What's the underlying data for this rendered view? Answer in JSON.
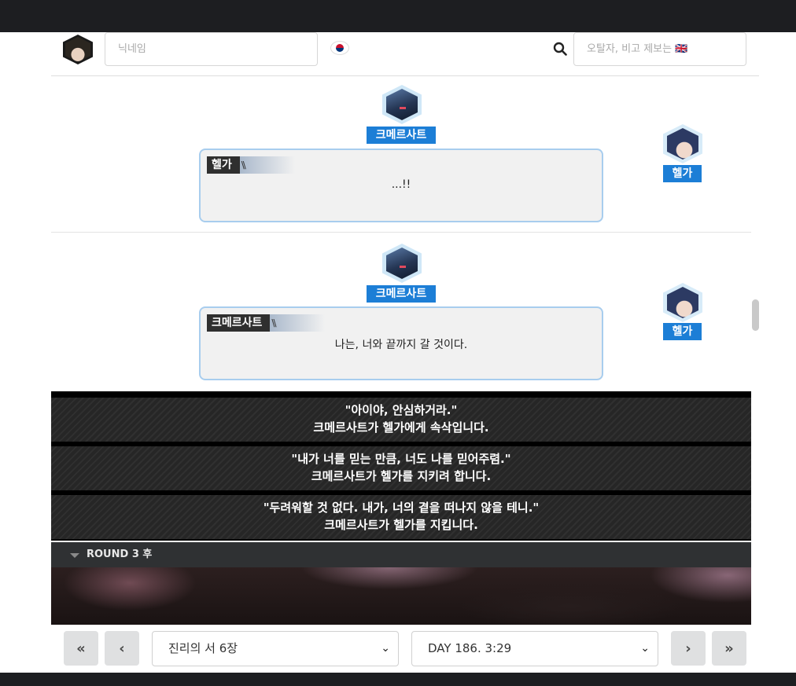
{
  "header": {
    "nickname_placeholder": "닉네임",
    "report_placeholder": "오탈자, 비고 제보는 🇬🇧"
  },
  "messages": [
    {
      "speaker": "크메르사트",
      "target": "헬가",
      "label": "헬가",
      "text": "...!!"
    },
    {
      "speaker": "크메르사트",
      "target": "헬가",
      "label": "크메르사트",
      "text": "나는, 너와 끝까지 갈 것이다."
    }
  ],
  "actions": [
    {
      "quote": "\"아이야, 안심하거라.\"",
      "desc": "크메르사트가 헬가에게 속삭입니다."
    },
    {
      "quote": "\"내가 너를 믿는 만큼, 너도 나를 믿어주렴.\"",
      "desc": "크메르사트가 헬가를 지키려 합니다."
    },
    {
      "quote": "\"두려워할 것 없다. 내가, 너의 곁을 떠나지 않을 테니.\"",
      "desc": "크메르사트가 헬가를 지킵니다."
    }
  ],
  "round": {
    "label": "ROUND 3 후"
  },
  "nav": {
    "chapter": "진리의 서 6장",
    "time": "DAY 186. 3:29",
    "first_icon": "«",
    "prev_icon": "‹",
    "next_icon": "›",
    "last_icon": "»"
  }
}
